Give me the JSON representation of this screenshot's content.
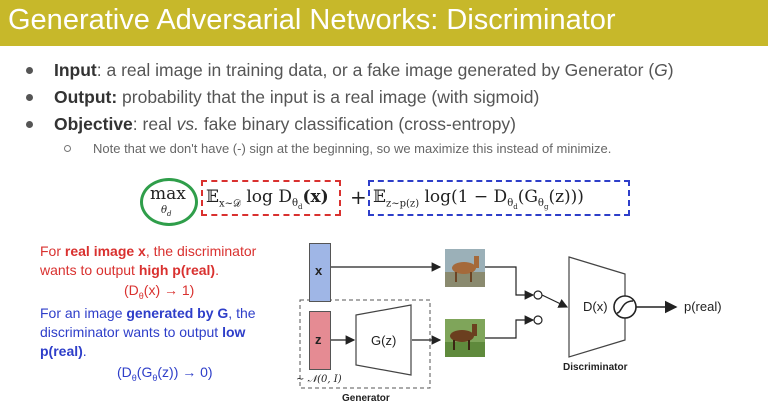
{
  "header": {
    "title": "Generative Adversarial Networks: Discriminator"
  },
  "bullets": [
    {
      "term": "Input",
      "text": ": a real image in training data, or a fake image generated by Generator (",
      "tail_symbol": "G",
      "tail_close": ")"
    },
    {
      "term": "Output:",
      "text": " probability that the input is a real image (with sigmoid)"
    },
    {
      "term": "Objective",
      "text_pre": ": real ",
      "vs": "vs.",
      "text_post": " fake binary classification (cross-entropy)"
    }
  ],
  "sub_bullet": "Note that we don't have (-) sign at the beginning, so we maximize this instead of minimize.",
  "formula": {
    "max": "max",
    "max_sub": "θ",
    "max_sub_idx": "d",
    "term1": "𝔼",
    "term1_sub": "x∼𝒟",
    "term1_rest": " log D",
    "term1_theta": "θ",
    "term1_idx": "d",
    "term1_arg": "(x)",
    "plus": "+",
    "term2": "𝔼",
    "term2_sub": "z∼p(z)",
    "term2_rest": " log(1 − D",
    "term2_theta": "θ",
    "term2_idx": "d",
    "term2_arg": "(G",
    "term2_gtheta": "θ",
    "term2_gidx": "g",
    "term2_end": "(z)))"
  },
  "left_text": {
    "real_prefix": "For ",
    "real_bold": "real image x",
    "real_mid": ", the discriminator",
    "real_line2_pre": "wants to output ",
    "real_line2_bold": "high p(real)",
    "real_line2_end": ".",
    "real_formula": "(D",
    "real_formula_sub": "θ",
    "real_formula_rest": "(x) → 1)",
    "fake_line1_pre": "For an image ",
    "fake_line1_bold": "generated by G",
    "fake_line1_end": ", the",
    "fake_line2_pre": "discriminator wants to output ",
    "fake_line2_bold": "low",
    "fake_line3_bold": "p(real)",
    "fake_line3_end": ".",
    "fake_formula": "(D",
    "fake_formula_sub": "θ",
    "fake_formula_mid": "(G",
    "fake_formula_sub2": "θ",
    "fake_formula_rest": "(z)) → 0)"
  },
  "diagram": {
    "x_label": "x",
    "z_label": "z",
    "gz_label": "G(z)",
    "dist_label": "∼ 𝒩(0, I)",
    "dx_label": "D(x)",
    "output_label": "p(real)",
    "discriminator_label": "Discriminator",
    "generator_label": "Generator"
  },
  "colors": {
    "title_bar": "#c7b82a",
    "red": "#d9312f",
    "blue": "#2e3ec9",
    "green": "#2f9e4a",
    "x_box": "#9fb6e6",
    "z_box": "#e58b93"
  }
}
